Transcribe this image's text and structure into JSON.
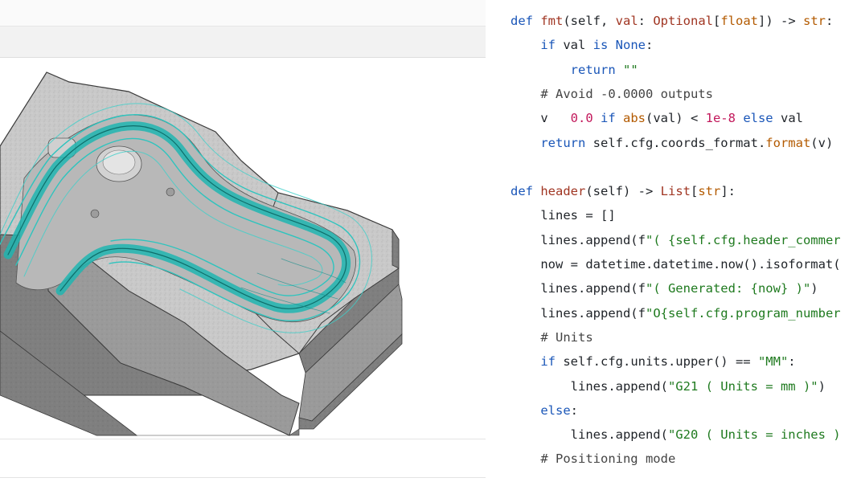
{
  "code": {
    "lines": [
      [
        {
          "t": "def ",
          "c": "kw"
        },
        {
          "t": "fmt",
          "c": "fn"
        },
        {
          "t": "(self, "
        },
        {
          "t": "val",
          "c": "fn"
        },
        {
          "t": ": "
        },
        {
          "t": "Optional",
          "c": "fn"
        },
        {
          "t": "["
        },
        {
          "t": "float",
          "c": "ty"
        },
        {
          "t": "]) -> "
        },
        {
          "t": "str",
          "c": "ty"
        },
        {
          "t": ":"
        }
      ],
      [
        {
          "t": "    "
        },
        {
          "t": "if ",
          "c": "kw"
        },
        {
          "t": "val "
        },
        {
          "t": "is ",
          "c": "kw"
        },
        {
          "t": "None",
          "c": "kw"
        },
        {
          "t": ":"
        }
      ],
      [
        {
          "t": "        "
        },
        {
          "t": "return ",
          "c": "kw"
        },
        {
          "t": "\"\"",
          "c": "st"
        }
      ],
      [
        {
          "t": "    "
        },
        {
          "t": "# Avoid -0.0000 outputs",
          "c": "cm"
        }
      ],
      [
        {
          "t": "    v   "
        },
        {
          "t": "0.0 ",
          "c": "nm"
        },
        {
          "t": "if ",
          "c": "kw"
        },
        {
          "t": "abs",
          "c": "bi"
        },
        {
          "t": "(val) < "
        },
        {
          "t": "1e-8 ",
          "c": "nm"
        },
        {
          "t": "else ",
          "c": "kw"
        },
        {
          "t": "val"
        }
      ],
      [
        {
          "t": "    "
        },
        {
          "t": "return ",
          "c": "kw"
        },
        {
          "t": "self.cfg.coords_format."
        },
        {
          "t": "format",
          "c": "bi"
        },
        {
          "t": "(v)"
        }
      ],
      [],
      [
        {
          "t": "def ",
          "c": "kw"
        },
        {
          "t": "header",
          "c": "fn"
        },
        {
          "t": "(self) -> "
        },
        {
          "t": "List",
          "c": "fn"
        },
        {
          "t": "["
        },
        {
          "t": "str",
          "c": "ty"
        },
        {
          "t": "]:"
        }
      ],
      [
        {
          "t": "    lines = []"
        }
      ],
      [
        {
          "t": "    lines.append(f"
        },
        {
          "t": "\"( {self.cfg.header_commer",
          "c": "st"
        }
      ],
      [
        {
          "t": "    now = datetime.datetime.now().isoformat("
        }
      ],
      [
        {
          "t": "    lines.append(f"
        },
        {
          "t": "\"( Generated: {now} )\"",
          "c": "st"
        },
        {
          "t": ")"
        }
      ],
      [
        {
          "t": "    lines.append(f"
        },
        {
          "t": "\"O{self.cfg.program_number",
          "c": "st"
        }
      ],
      [
        {
          "t": "    "
        },
        {
          "t": "# Units",
          "c": "cm"
        }
      ],
      [
        {
          "t": "    "
        },
        {
          "t": "if ",
          "c": "kw"
        },
        {
          "t": "self.cfg.units.upper() == "
        },
        {
          "t": "\"MM\"",
          "c": "st"
        },
        {
          "t": ":"
        }
      ],
      [
        {
          "t": "        lines.append("
        },
        {
          "t": "\"G21 ( Units = mm )\"",
          "c": "st"
        },
        {
          "t": ")"
        }
      ],
      [
        {
          "t": "    "
        },
        {
          "t": "else",
          "c": "kw"
        },
        {
          "t": ":"
        }
      ],
      [
        {
          "t": "        lines.append("
        },
        {
          "t": "\"G20 ( Units = inches )",
          "c": "st"
        }
      ],
      [
        {
          "t": "    "
        },
        {
          "t": "# Positioning mode",
          "c": "cm"
        }
      ]
    ]
  },
  "colors": {
    "keyword": "#1a56b8",
    "function": "#a03522",
    "type": "#b35a00",
    "string": "#1f7a1f",
    "number": "#c2185b",
    "toolpath": "#1fb5b0"
  }
}
